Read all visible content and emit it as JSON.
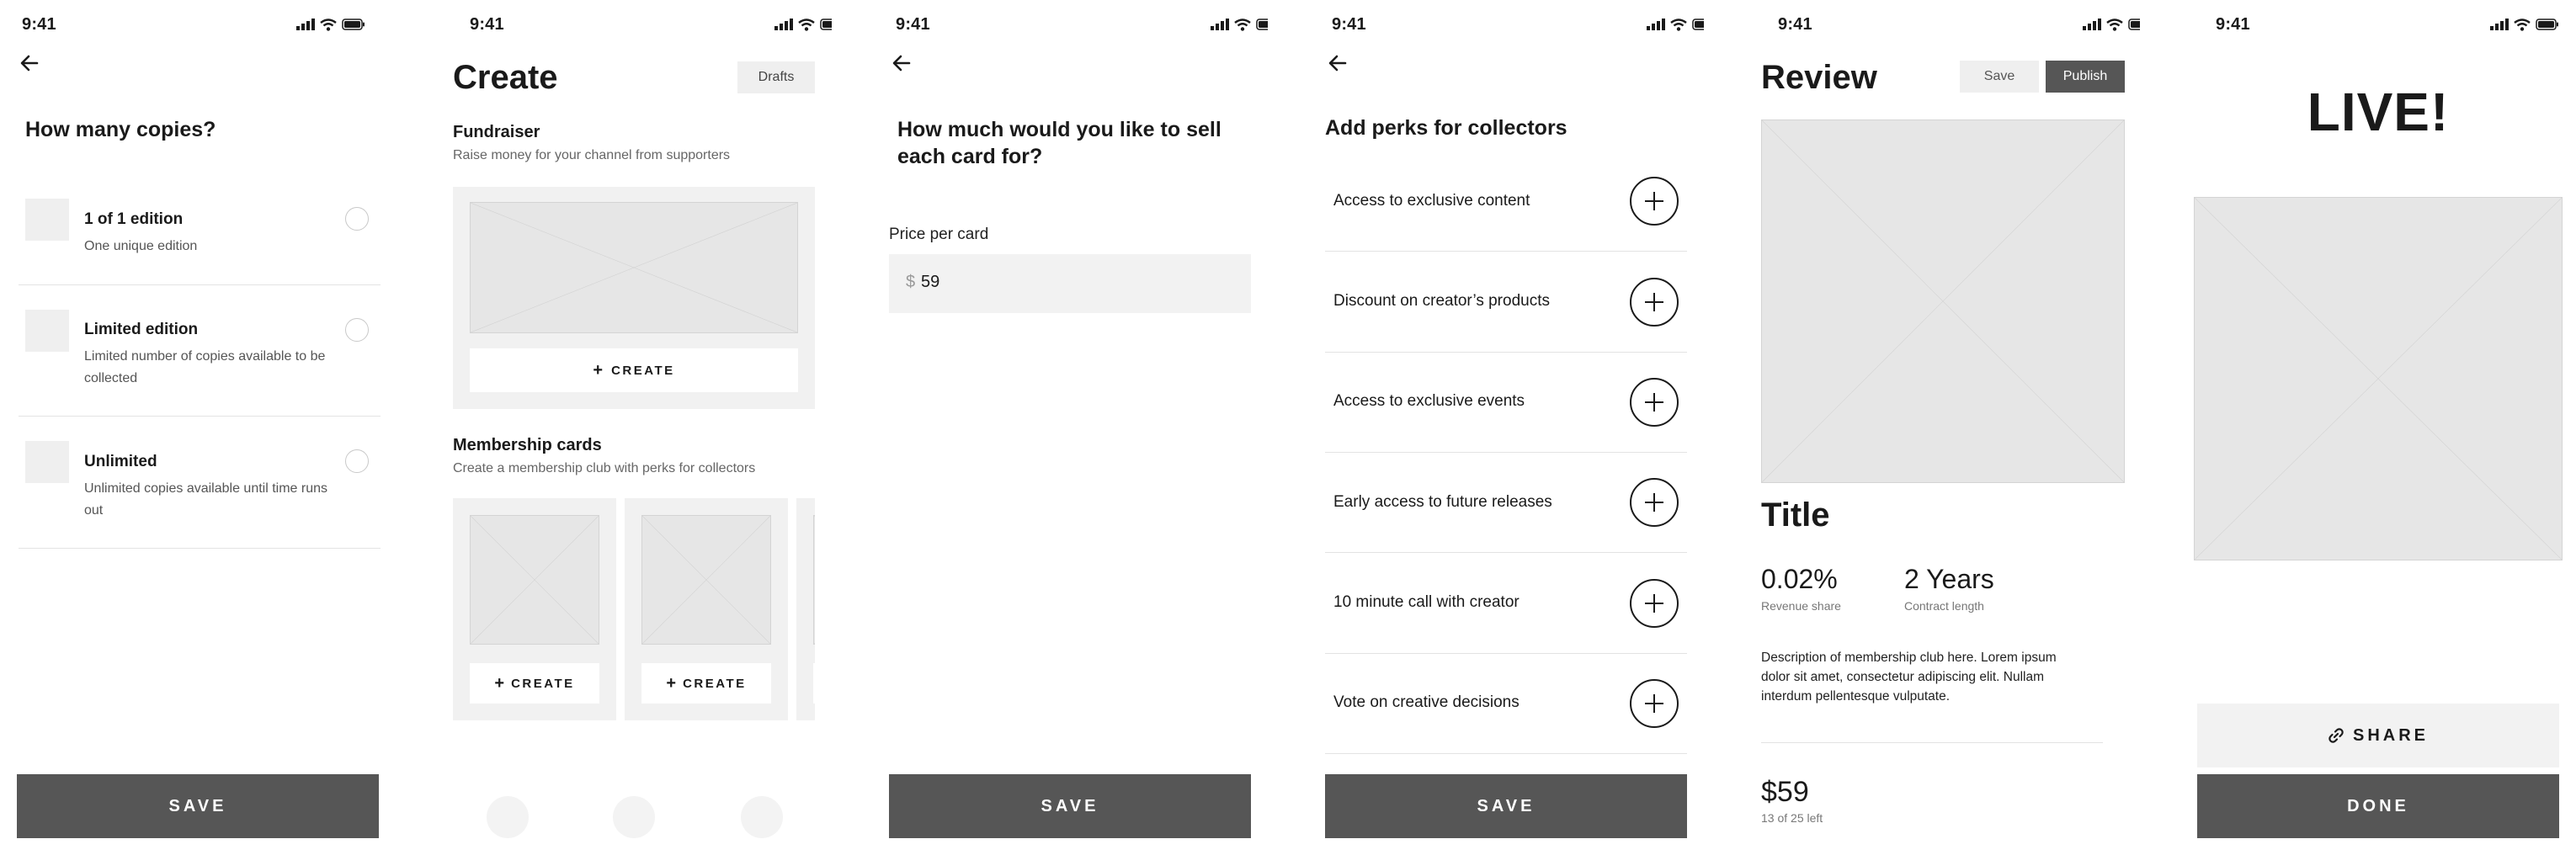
{
  "status": {
    "time": "9:41"
  },
  "copies_screen": {
    "title": "How many copies?",
    "options": [
      {
        "title": "1 of 1 edition",
        "desc": "One unique edition"
      },
      {
        "title": "Limited edition",
        "desc": "Limited number of copies available to be collected"
      },
      {
        "title": "Unlimited",
        "desc": "Unlimited copies available until time runs out"
      }
    ],
    "save_label": "SAVE"
  },
  "create_screen": {
    "title": "Create",
    "drafts_label": "Drafts",
    "fundraiser": {
      "title": "Fundraiser",
      "subtitle": "Raise money for your channel from supporters",
      "create_label": "CREATE"
    },
    "membership": {
      "title": "Membership cards",
      "subtitle": "Create a membership club with perks for collectors",
      "create_label": "CREATE"
    }
  },
  "price_screen": {
    "title": "How much would you like to sell each card for?",
    "field_label": "Price per card",
    "currency": "$",
    "price_value": "59",
    "save_label": "SAVE"
  },
  "perks_screen": {
    "title": "Add perks for collectors",
    "perks": [
      "Access to exclusive content",
      "Discount on creator’s products",
      "Access to exclusive events",
      "Early access to future releases",
      "10 minute call with creator",
      "Vote on creative decisions"
    ],
    "save_label": "SAVE"
  },
  "review_screen": {
    "title": "Review",
    "save_label": "Save",
    "publish_label": "Publish",
    "card_title": "Title",
    "revenue_share": {
      "value": "0.02%",
      "label": "Revenue share"
    },
    "contract_length": {
      "value": "2 Years",
      "label": "Contract length"
    },
    "description": "Description of membership club here. Lorem ipsum dolor sit amet, consectetur adipiscing elit. Nullam interdum pellentesque vulputate.",
    "price": "$59",
    "remaining": "13 of 25 left"
  },
  "live_screen": {
    "title": "LIVE!",
    "share_label": "SHARE",
    "done_label": "DONE"
  }
}
